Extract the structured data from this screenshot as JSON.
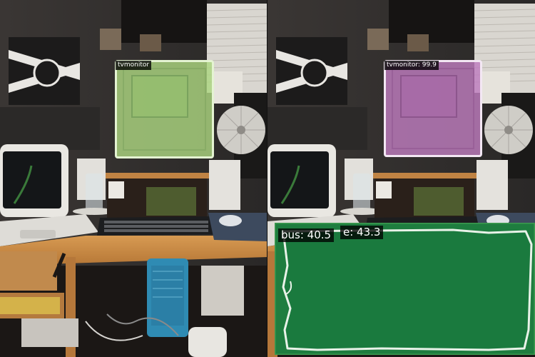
{
  "left_panel": {
    "detections": [
      {
        "label": "tvmonitor",
        "box_color": "#acd680"
      }
    ]
  },
  "right_panel": {
    "detections": [
      {
        "label": "tvmonitor: 99.9",
        "box_color": "#be7dbe"
      },
      {
        "label": "bus: 40.5",
        "box_color": "#1a7a3e"
      },
      {
        "label": "e: 43.3",
        "box_color": "#1a7a3e"
      }
    ]
  },
  "colors": {
    "mask_green": "#1a7a3e",
    "mask_outline": "#e8f2e8",
    "label_bg": "#000000",
    "label_text": "#ffffff"
  }
}
